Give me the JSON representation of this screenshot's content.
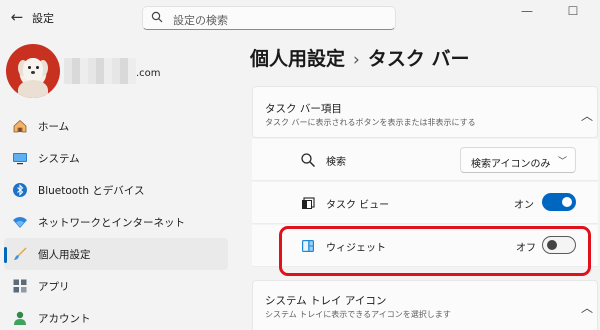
{
  "window": {
    "title": "設定",
    "back_glyph": "←",
    "minimize_glyph": "—",
    "maximize_glyph": "☐"
  },
  "search": {
    "placeholder": "設定の検索"
  },
  "profile": {
    "email_suffix": ".com"
  },
  "sidebar": {
    "items": [
      {
        "label": "ホーム",
        "icon": "home-icon"
      },
      {
        "label": "システム",
        "icon": "system-icon"
      },
      {
        "label": "Bluetooth とデバイス",
        "icon": "bluetooth-icon"
      },
      {
        "label": "ネットワークとインターネット",
        "icon": "wifi-icon"
      },
      {
        "label": "個人用設定",
        "icon": "brush-icon",
        "active": true
      },
      {
        "label": "アプリ",
        "icon": "apps-icon"
      },
      {
        "label": "アカウント",
        "icon": "account-icon"
      }
    ]
  },
  "breadcrumb": {
    "parent": "個人用設定",
    "separator": "›",
    "current": "タスク バー"
  },
  "taskbar_items": {
    "title": "タスク バー項目",
    "subtitle": "タスク バーに表示されるボタンを表示または非表示にする",
    "rows": [
      {
        "label": "検索",
        "icon": "search-icon",
        "control": "dropdown",
        "value": "検索アイコンのみ"
      },
      {
        "label": "タスク ビュー",
        "icon": "task-view-icon",
        "control": "toggle",
        "state": "オン",
        "on": true
      },
      {
        "label": "ウィジェット",
        "icon": "widgets-icon",
        "control": "toggle",
        "state": "オフ",
        "on": false
      }
    ]
  },
  "system_tray": {
    "title": "システム トレイ アイコン",
    "subtitle": "システム トレイに表示できるアイコンを選択します"
  },
  "colors": {
    "accent": "#0067c0",
    "highlight": "#e0111b"
  }
}
